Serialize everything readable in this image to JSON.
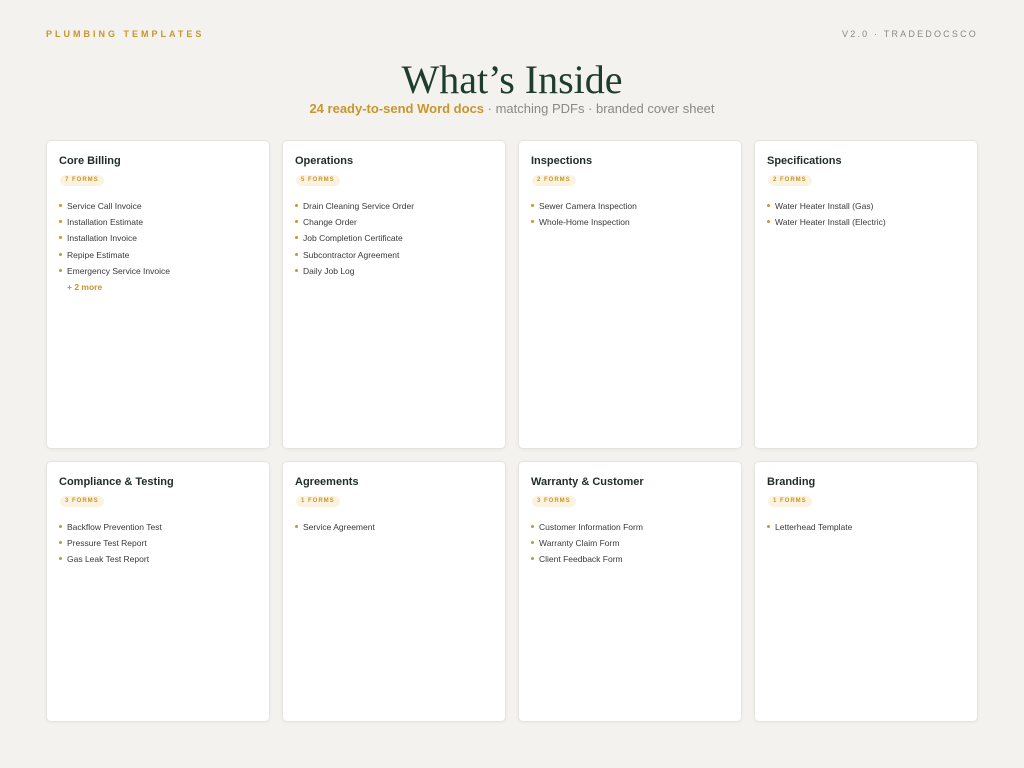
{
  "header": {
    "brand": "PLUMBING TEMPLATES",
    "version": "V2.0 · TRADEDOCSCO"
  },
  "title": "What’s Inside",
  "subtitle": {
    "highlight": "24 ready-to-send Word docs",
    "rest": " · matching PDFs · branded cover sheet"
  },
  "colors": {
    "accent": "#c8962c",
    "title": "#1e3d2e",
    "background": "#f3f2ee"
  },
  "categories": [
    {
      "name": "Core Billing",
      "badge": "7 FORMS",
      "items": [
        "Service Call Invoice",
        "Installation Estimate",
        "Installation Invoice",
        "Repipe Estimate",
        "Emergency Service Invoice"
      ],
      "more": "+ 2 more"
    },
    {
      "name": "Operations",
      "badge": "5 FORMS",
      "items": [
        "Drain Cleaning Service Order",
        "Change Order",
        "Job Completion Certificate",
        "Subcontractor Agreement",
        "Daily Job Log"
      ],
      "more": ""
    },
    {
      "name": "Inspections",
      "badge": "2 FORMS",
      "items": [
        "Sewer Camera Inspection",
        "Whole-Home Inspection"
      ],
      "more": ""
    },
    {
      "name": "Specifications",
      "badge": "2 FORMS",
      "items": [
        "Water Heater Install (Gas)",
        "Water Heater Install (Electric)"
      ],
      "more": ""
    },
    {
      "name": "Compliance & Testing",
      "badge": "3 FORMS",
      "items": [
        "Backflow Prevention Test",
        "Pressure Test Report",
        "Gas Leak Test Report"
      ],
      "more": ""
    },
    {
      "name": "Agreements",
      "badge": "1 FORMS",
      "items": [
        "Service Agreement"
      ],
      "more": ""
    },
    {
      "name": "Warranty & Customer",
      "badge": "3 FORMS",
      "items": [
        "Customer Information Form",
        "Warranty Claim Form",
        "Client Feedback Form"
      ],
      "more": ""
    },
    {
      "name": "Branding",
      "badge": "1 FORMS",
      "items": [
        "Letterhead Template"
      ],
      "more": ""
    }
  ]
}
